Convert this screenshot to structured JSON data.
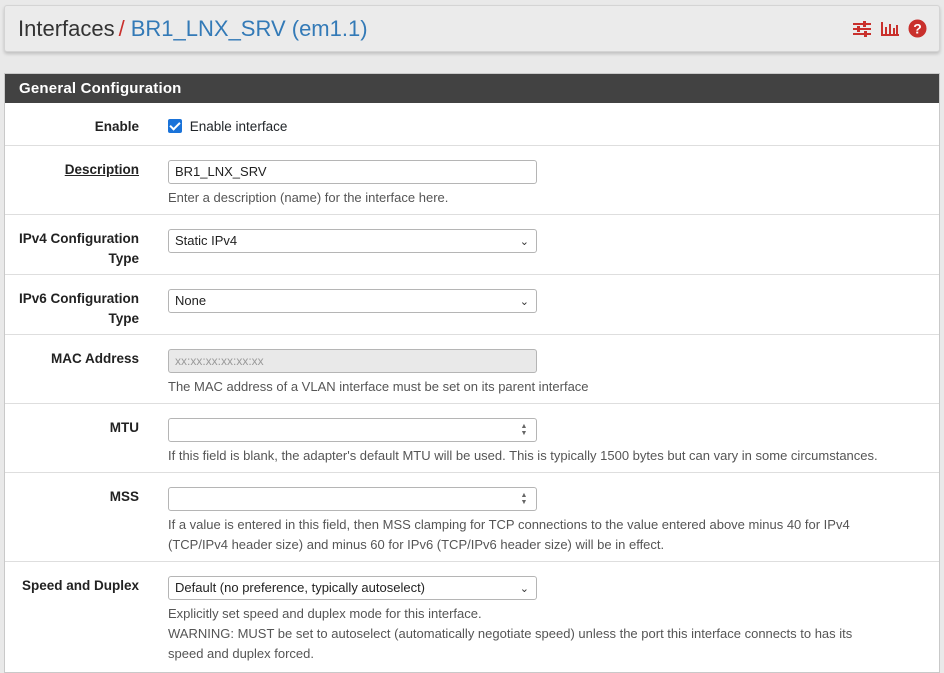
{
  "header": {
    "crumb_root": "Interfaces",
    "crumb_sep": "/",
    "crumb_current": "BR1_LNX_SRV (em1.1)",
    "icons": [
      "settings-sliders-icon",
      "bar-chart-icon",
      "help-icon"
    ]
  },
  "panel": {
    "title": "General Configuration"
  },
  "enable": {
    "label": "Enable",
    "checkbox_label": "Enable interface",
    "checked": true
  },
  "description": {
    "label": "Description",
    "value": "BR1_LNX_SRV",
    "help": "Enter a description (name) for the interface here."
  },
  "ipv4": {
    "label_line1": "IPv4 Configuration",
    "label_line2": "Type",
    "value": "Static IPv4"
  },
  "ipv6": {
    "label_line1": "IPv6 Configuration",
    "label_line2": "Type",
    "value": "None"
  },
  "mac": {
    "label": "MAC Address",
    "placeholder": "xx:xx:xx:xx:xx:xx",
    "help": "The MAC address of a VLAN interface must be set on its parent interface"
  },
  "mtu": {
    "label": "MTU",
    "value": "",
    "help": "If this field is blank, the adapter's default MTU will be used. This is typically 1500 bytes but can vary in some circumstances."
  },
  "mss": {
    "label": "MSS",
    "value": "",
    "help_line1": "If a value is entered in this field, then MSS clamping for TCP connections to the value entered above minus 40 for IPv4",
    "help_line2": "(TCP/IPv4 header size) and minus 60 for IPv6 (TCP/IPv6 header size) will be in effect."
  },
  "speed": {
    "label": "Speed and Duplex",
    "value": "Default (no preference, typically autoselect)",
    "help_line1": "Explicitly set speed and duplex mode for this interface.",
    "help_line2": "WARNING: MUST be set to autoselect (automatically negotiate speed) unless the port this interface connects to has its",
    "help_line3": "speed and duplex forced."
  },
  "colors": {
    "accent_red": "#c9302c",
    "link_blue": "#337ab7",
    "panel_heading": "#424242",
    "checkbox_blue": "#1a73d9"
  }
}
